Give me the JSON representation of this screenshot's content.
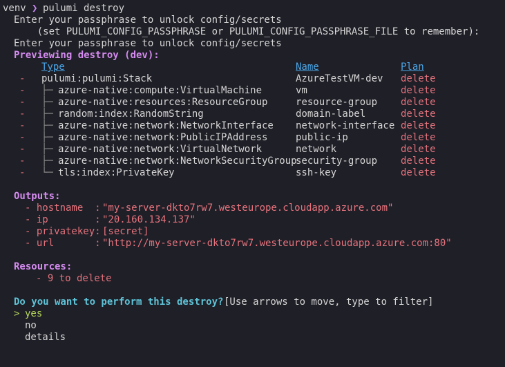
{
  "prompt": {
    "env": "venv",
    "arrow": "❯",
    "command": "pulumi destroy"
  },
  "passphrase_lines": [
    "Enter your passphrase to unlock config/secrets",
    "    (set PULUMI_CONFIG_PASSPHRASE or PULUMI_CONFIG_PASSPHRASE_FILE to remember):",
    "Enter your passphrase to unlock config/secrets"
  ],
  "preview_heading": "Previewing destroy (dev):",
  "table": {
    "headers": {
      "type": "Type",
      "name": "Name",
      "plan": "Plan"
    },
    "rows": [
      {
        "op": "-",
        "tree": "",
        "type": "pulumi:pulumi:Stack",
        "name": "AzureTestVM-dev",
        "plan": "delete"
      },
      {
        "op": "-",
        "tree": "├─",
        "type": "azure-native:compute:VirtualMachine",
        "name": "vm",
        "plan": "delete"
      },
      {
        "op": "-",
        "tree": "├─",
        "type": "azure-native:resources:ResourceGroup",
        "name": "resource-group",
        "plan": "delete"
      },
      {
        "op": "-",
        "tree": "├─",
        "type": "random:index:RandomString",
        "name": "domain-label",
        "plan": "delete"
      },
      {
        "op": "-",
        "tree": "├─",
        "type": "azure-native:network:NetworkInterface",
        "name": "network-interface",
        "plan": "delete"
      },
      {
        "op": "-",
        "tree": "├─",
        "type": "azure-native:network:PublicIPAddress",
        "name": "public-ip",
        "plan": "delete"
      },
      {
        "op": "-",
        "tree": "├─",
        "type": "azure-native:network:VirtualNetwork",
        "name": "network",
        "plan": "delete"
      },
      {
        "op": "-",
        "tree": "├─",
        "type": "azure-native:network:NetworkSecurityGroup",
        "name": "security-group",
        "plan": "delete"
      },
      {
        "op": "-",
        "tree": "└─",
        "type": "tls:index:PrivateKey",
        "name": "ssh-key",
        "plan": "delete"
      }
    ]
  },
  "outputs": {
    "heading": "Outputs:",
    "items": [
      {
        "key": "- hostname  : ",
        "value": "\"my-server-dkto7rw7.westeurope.cloudapp.azure.com\""
      },
      {
        "key": "- ip        : ",
        "value": "\"20.160.134.137\""
      },
      {
        "key": "- privatekey: ",
        "value": "[secret]"
      },
      {
        "key": "- url       : ",
        "value": "\"http://my-server-dkto7rw7.westeurope.cloudapp.azure.com:80\""
      }
    ]
  },
  "resources": {
    "heading": "Resources:",
    "summary": "- 9 to delete"
  },
  "question": {
    "text": "Do you want to perform this destroy?",
    "hint": "[Use arrows to move, type to filter]",
    "cursor": ">",
    "options": [
      "yes",
      "no",
      "details"
    ]
  },
  "colors": {
    "background": "#1f1f27",
    "heading_purple": "#d58bf0",
    "header_blue": "#4aa6e8",
    "delete_red": "#e2727c",
    "question_cyan": "#5fc4d8",
    "selected_green": "#b7d85c"
  }
}
